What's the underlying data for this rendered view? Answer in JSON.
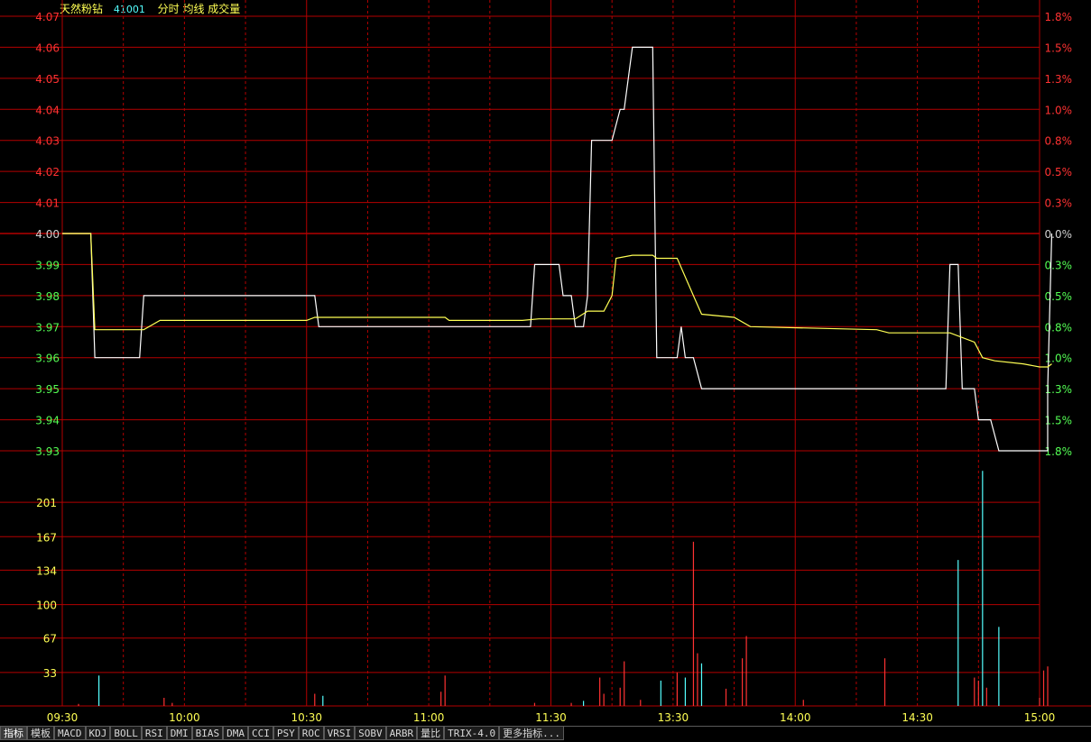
{
  "header": {
    "name": "天然粉钻",
    "code": "41001",
    "labels": "分时 均线 成交量"
  },
  "tabs": [
    "指标",
    "模板",
    "MACD",
    "KDJ",
    "BOLL",
    "RSI",
    "DMI",
    "BIAS",
    "DMA",
    "CCI",
    "PSY",
    "ROC",
    "VRSI",
    "SOBV",
    "ARBR",
    "量比",
    "TRIX-4.0",
    "更多指标..."
  ],
  "colors": {
    "grid": "#b40000",
    "price_line": "#ffffff",
    "avg_line": "#ffff54",
    "up": "#ff3232",
    "down": "#54ff54",
    "flat": "#d0d0d0",
    "vol_up": "#ff3232",
    "vol_down": "#54ffff",
    "vol_axis": "#ffff54"
  },
  "chart_data": [
    {
      "type": "line",
      "title": "分时",
      "prev_close": 4.0,
      "ylim": [
        3.93,
        4.07
      ],
      "price_ticks": [
        "4.07",
        "4.06",
        "4.05",
        "4.04",
        "4.03",
        "4.02",
        "4.01",
        "4.00",
        "3.99",
        "3.98",
        "3.97",
        "3.96",
        "3.95",
        "3.94",
        "3.93"
      ],
      "pct_ticks": [
        "1.8%",
        "1.5%",
        "1.3%",
        "1.0%",
        "0.8%",
        "0.5%",
        "0.3%",
        "0.0%",
        "0.3%",
        "0.5%",
        "0.8%",
        "1.0%",
        "1.3%",
        "1.5%",
        "1.8%"
      ],
      "x_ticks": [
        "09:30",
        "10:00",
        "10:30",
        "11:00",
        "11:30",
        "13:30",
        "14:00",
        "14:30",
        "15:00"
      ],
      "x_range_minutes": [
        0,
        240
      ],
      "series": [
        {
          "name": "分时",
          "points": [
            [
              0,
              4.0
            ],
            [
              7,
              4.0
            ],
            [
              8,
              3.96
            ],
            [
              19,
              3.96
            ],
            [
              20,
              3.98
            ],
            [
              62,
              3.98
            ],
            [
              63,
              3.97
            ],
            [
              115,
              3.97
            ],
            [
              116,
              3.99
            ],
            [
              122,
              3.99
            ],
            [
              123,
              3.98
            ],
            [
              125,
              3.98
            ],
            [
              126,
              3.97
            ],
            [
              128,
              3.97
            ],
            [
              129,
              3.98
            ],
            [
              130,
              4.03
            ],
            [
              135,
              4.03
            ],
            [
              137,
              4.04
            ],
            [
              138,
              4.04
            ],
            [
              140,
              4.06
            ],
            [
              145,
              4.06
            ],
            [
              146,
              3.96
            ],
            [
              151,
              3.96
            ],
            [
              152,
              3.97
            ],
            [
              153,
              3.96
            ],
            [
              155,
              3.96
            ],
            [
              157,
              3.95
            ],
            [
              217,
              3.95
            ],
            [
              218,
              3.99
            ],
            [
              220,
              3.99
            ],
            [
              221,
              3.95
            ],
            [
              224,
              3.95
            ],
            [
              225,
              3.94
            ],
            [
              228,
              3.94
            ],
            [
              230,
              3.93
            ],
            [
              242,
              3.93
            ],
            [
              242,
              3.95
            ],
            [
              243,
              4.0
            ]
          ]
        },
        {
          "name": "均线",
          "points": [
            [
              0,
              4.0
            ],
            [
              7,
              4.0
            ],
            [
              8,
              3.969
            ],
            [
              20,
              3.969
            ],
            [
              24,
              3.972
            ],
            [
              60,
              3.972
            ],
            [
              62,
              3.973
            ],
            [
              94,
              3.973
            ],
            [
              95,
              3.972
            ],
            [
              113,
              3.972
            ],
            [
              117,
              3.9725
            ],
            [
              126,
              3.9725
            ],
            [
              129,
              3.975
            ],
            [
              133,
              3.975
            ],
            [
              135,
              3.98
            ],
            [
              136,
              3.992
            ],
            [
              140,
              3.993
            ],
            [
              145,
              3.993
            ],
            [
              146,
              3.992
            ],
            [
              151,
              3.992
            ],
            [
              155,
              3.98
            ],
            [
              157,
              3.974
            ],
            [
              165,
              3.973
            ],
            [
              169,
              3.97
            ],
            [
              200,
              3.969
            ],
            [
              203,
              3.968
            ],
            [
              218,
              3.968
            ],
            [
              224,
              3.965
            ],
            [
              226,
              3.96
            ],
            [
              229,
              3.959
            ],
            [
              236,
              3.958
            ],
            [
              240,
              3.957
            ],
            [
              242,
              3.957
            ],
            [
              243,
              3.958
            ]
          ]
        }
      ]
    },
    {
      "type": "bar",
      "title": "成交量",
      "ylim": [
        0,
        234
      ],
      "y_ticks": [
        "201",
        "167",
        "134",
        "100",
        "67",
        "33"
      ],
      "bars": [
        {
          "x": 4,
          "v": 2,
          "c": "up"
        },
        {
          "x": 9,
          "v": 30,
          "c": "down"
        },
        {
          "x": 25,
          "v": 8,
          "c": "up"
        },
        {
          "x": 27,
          "v": 3,
          "c": "up"
        },
        {
          "x": 62,
          "v": 12,
          "c": "up"
        },
        {
          "x": 64,
          "v": 10,
          "c": "down"
        },
        {
          "x": 93,
          "v": 14,
          "c": "up"
        },
        {
          "x": 94,
          "v": 30,
          "c": "up"
        },
        {
          "x": 116,
          "v": 3,
          "c": "up"
        },
        {
          "x": 125,
          "v": 3,
          "c": "up"
        },
        {
          "x": 128,
          "v": 5,
          "c": "down"
        },
        {
          "x": 132,
          "v": 28,
          "c": "up"
        },
        {
          "x": 133,
          "v": 12,
          "c": "up"
        },
        {
          "x": 137,
          "v": 18,
          "c": "up"
        },
        {
          "x": 138,
          "v": 44,
          "c": "up"
        },
        {
          "x": 142,
          "v": 6,
          "c": "up"
        },
        {
          "x": 147,
          "v": 25,
          "c": "down"
        },
        {
          "x": 151,
          "v": 33,
          "c": "up"
        },
        {
          "x": 153,
          "v": 28,
          "c": "down"
        },
        {
          "x": 155,
          "v": 162,
          "c": "up"
        },
        {
          "x": 156,
          "v": 52,
          "c": "up"
        },
        {
          "x": 157,
          "v": 42,
          "c": "down"
        },
        {
          "x": 163,
          "v": 17,
          "c": "up"
        },
        {
          "x": 167,
          "v": 47,
          "c": "up"
        },
        {
          "x": 168,
          "v": 69,
          "c": "up"
        },
        {
          "x": 182,
          "v": 6,
          "c": "up"
        },
        {
          "x": 202,
          "v": 47,
          "c": "up"
        },
        {
          "x": 220,
          "v": 144,
          "c": "down"
        },
        {
          "x": 224,
          "v": 28,
          "c": "up"
        },
        {
          "x": 225,
          "v": 25,
          "c": "up"
        },
        {
          "x": 226,
          "v": 232,
          "c": "down"
        },
        {
          "x": 227,
          "v": 18,
          "c": "up"
        },
        {
          "x": 230,
          "v": 78,
          "c": "down"
        },
        {
          "x": 240,
          "v": 8,
          "c": "up"
        },
        {
          "x": 241,
          "v": 35,
          "c": "up"
        },
        {
          "x": 242,
          "v": 39,
          "c": "up"
        }
      ]
    }
  ]
}
